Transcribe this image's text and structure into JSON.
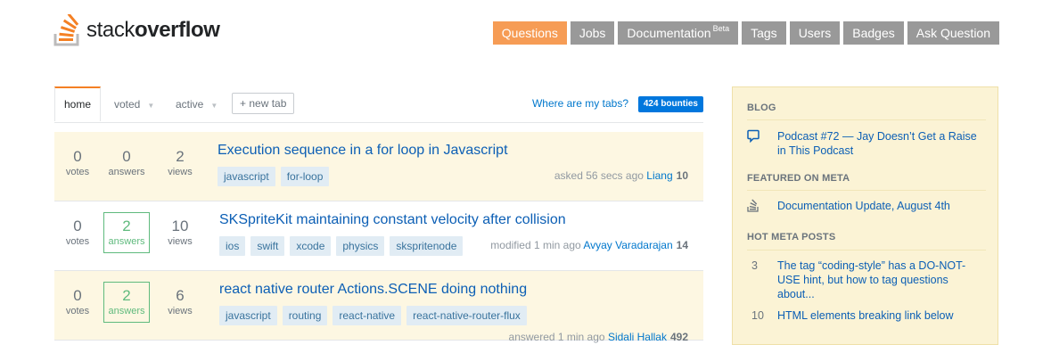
{
  "logo": {
    "text_light": "stack",
    "text_bold": "overflow"
  },
  "nav": [
    {
      "label": "Questions",
      "active": true
    },
    {
      "label": "Jobs"
    },
    {
      "label": "Documentation",
      "badge": "Beta"
    },
    {
      "label": "Tags"
    },
    {
      "label": "Users"
    },
    {
      "label": "Badges"
    },
    {
      "label": "Ask Question"
    }
  ],
  "tabs": {
    "home": "home",
    "voted": "voted",
    "active": "active",
    "new_tab": "+ new tab",
    "where": "Where are my tabs?",
    "bounties": "424 bounties"
  },
  "questions": [
    {
      "votes": "0",
      "votes_label": "votes",
      "answers": "0",
      "answers_label": "answers",
      "views": "2",
      "views_label": "views",
      "title": "Execution sequence in a for loop in Javascript",
      "tags": [
        "javascript",
        "for-loop"
      ],
      "action": "asked 56 secs ago",
      "user": "Liang",
      "rep": "10"
    },
    {
      "votes": "0",
      "votes_label": "votes",
      "answers": "2",
      "answers_label": "answers",
      "views": "10",
      "views_label": "views",
      "title": "SKSpriteKit maintaining constant velocity after collision",
      "tags": [
        "ios",
        "swift",
        "xcode",
        "physics",
        "skspritenode"
      ],
      "action": "modified 1 min ago",
      "user": "Avyay Varadarajan",
      "rep": "14"
    },
    {
      "votes": "0",
      "votes_label": "votes",
      "answers": "2",
      "answers_label": "answers",
      "views": "6",
      "views_label": "views",
      "title": "react native router Actions.SCENE doing nothing",
      "tags": [
        "javascript",
        "routing",
        "react-native",
        "react-native-router-flux"
      ],
      "action": "answered 1 min ago",
      "user": "Sidali Hallak",
      "rep": "492"
    }
  ],
  "sidebar": {
    "blog_head": "BLOG",
    "blog_item": "Podcast #72 — Jay Doesn’t Get a Raise in This Podcast",
    "featured_head": "FEATURED ON META",
    "featured_item": "Documentation Update, August 4th",
    "hot_head": "HOT META POSTS",
    "hot": [
      {
        "count": "3",
        "text": "The tag “coding-style” has a DO-NOT-USE hint, but how to tag questions about..."
      },
      {
        "count": "10",
        "text": "HTML elements breaking link below"
      }
    ]
  },
  "colors": {
    "accent": "#f69c55",
    "nav": "#999999",
    "link": "#0c5fb5",
    "tag_bg": "#e1ecf4",
    "highlight": "#fdf7e2",
    "accepted": "#5fba7d"
  }
}
